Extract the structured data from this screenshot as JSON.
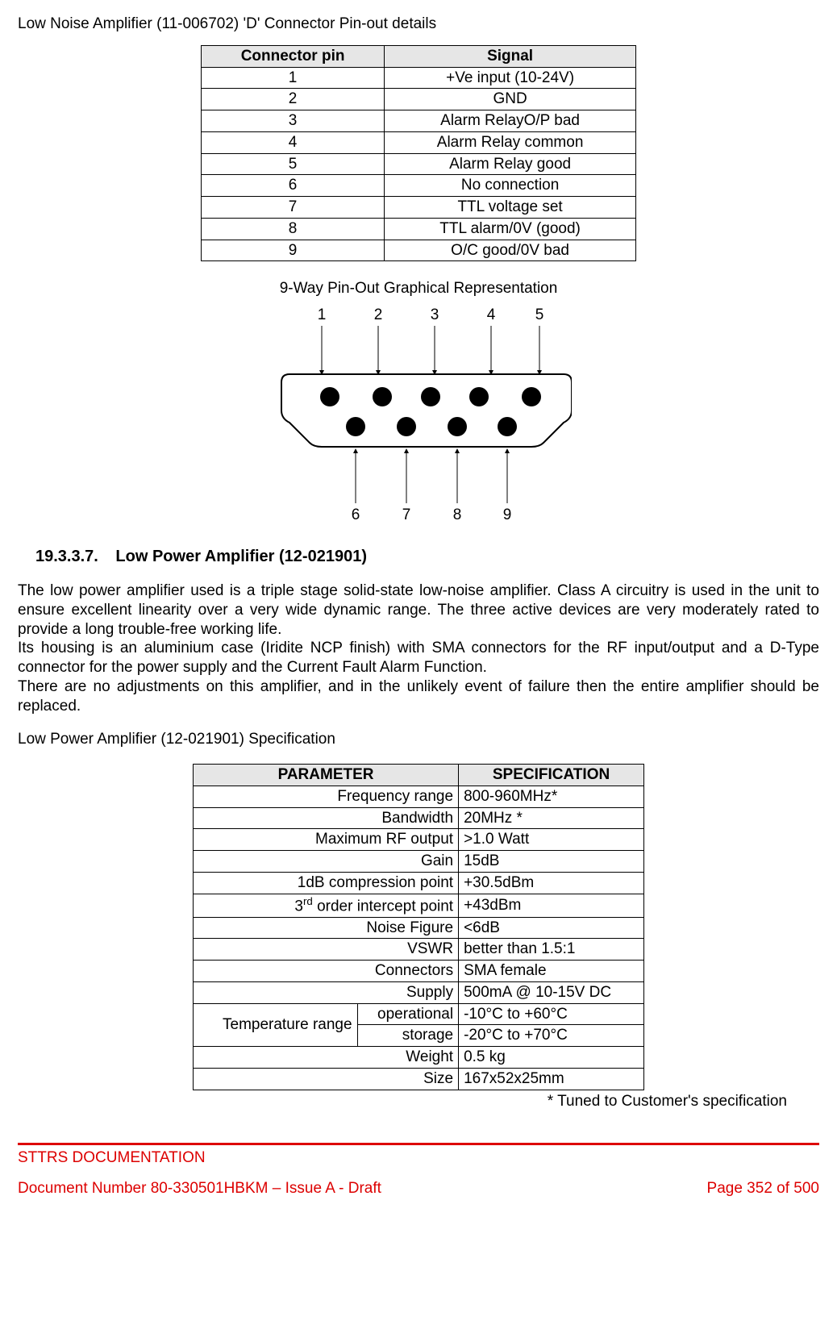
{
  "title1": "Low Noise Amplifier (11-006702) 'D' Connector Pin-out details",
  "pinout_table": {
    "head": [
      "Connector pin",
      "Signal"
    ],
    "rows": [
      [
        "1",
        "+Ve input (10-24V)"
      ],
      [
        "2",
        "GND"
      ],
      [
        "3",
        "Alarm RelayO/P bad"
      ],
      [
        "4",
        "Alarm Relay common"
      ],
      [
        "5",
        "Alarm Relay good"
      ],
      [
        "6",
        "No connection"
      ],
      [
        "7",
        "TTL voltage set"
      ],
      [
        "8",
        "TTL alarm/0V (good)"
      ],
      [
        "9",
        "O/C good/0V bad"
      ]
    ]
  },
  "diagram_caption": "9-Way Pin-Out Graphical Representation",
  "diagram_pins_top": [
    "1",
    "2",
    "3",
    "4",
    "5"
  ],
  "diagram_pins_bottom": [
    "6",
    "7",
    "8",
    "9"
  ],
  "section": {
    "number": "19.3.3.7.",
    "title": "Low Power Amplifier (12-021901)"
  },
  "paragraphs": {
    "p1": "The low power amplifier used is a triple stage solid-state low-noise amplifier. Class A circuitry is used in the unit to ensure excellent linearity over a very wide dynamic range. The three active devices are very moderately rated to provide a long trouble-free working life.",
    "p2": "Its housing is an aluminium case (Iridite NCP finish) with SMA connectors for the RF input/output and a D-Type connector for the power supply and the Current Fault Alarm Function.",
    "p3": "There are no adjustments on this amplifier, and in the unlikely event of failure then the entire amplifier should be replaced.",
    "spec_intro": "Low Power Amplifier (12-021901) Specification"
  },
  "spec_table": {
    "head": [
      "PARAMETER",
      "SPECIFICATION"
    ],
    "rows_simple": [
      {
        "param": "Frequency range",
        "val": "800-960MHz*"
      },
      {
        "param": "Bandwidth",
        "val": "20MHz *"
      },
      {
        "param": "Maximum RF output",
        "val": ">1.0 Watt"
      },
      {
        "param": "Gain",
        "val": "15dB"
      },
      {
        "param": "1dB compression point",
        "val": "+30.5dBm"
      },
      {
        "param_html": "3<sup>rd</sup> order intercept point",
        "val": "+43dBm"
      },
      {
        "param": "Noise Figure",
        "val": "<6dB"
      },
      {
        "param": "VSWR",
        "val": "better than 1.5:1"
      },
      {
        "param": "Connectors",
        "val": "SMA female"
      },
      {
        "param": "Supply",
        "val": "500mA @ 10-15V DC"
      }
    ],
    "temp_group": {
      "group_label": "Temperature range",
      "rows": [
        {
          "sub": "operational",
          "val": "-10°C to +60°C"
        },
        {
          "sub": "storage",
          "val": "-20°C to +70°C"
        }
      ]
    },
    "rows_after": [
      {
        "param": "Weight",
        "val": "0.5 kg"
      },
      {
        "param": "Size",
        "val": "167x52x25mm"
      }
    ]
  },
  "tuned_note": "* Tuned to Customer's specification",
  "footer": {
    "org": "STTRS DOCUMENTATION",
    "left": "Document Number 80-330501HBKM – Issue A - Draft",
    "right": "Page 352 of 500"
  }
}
